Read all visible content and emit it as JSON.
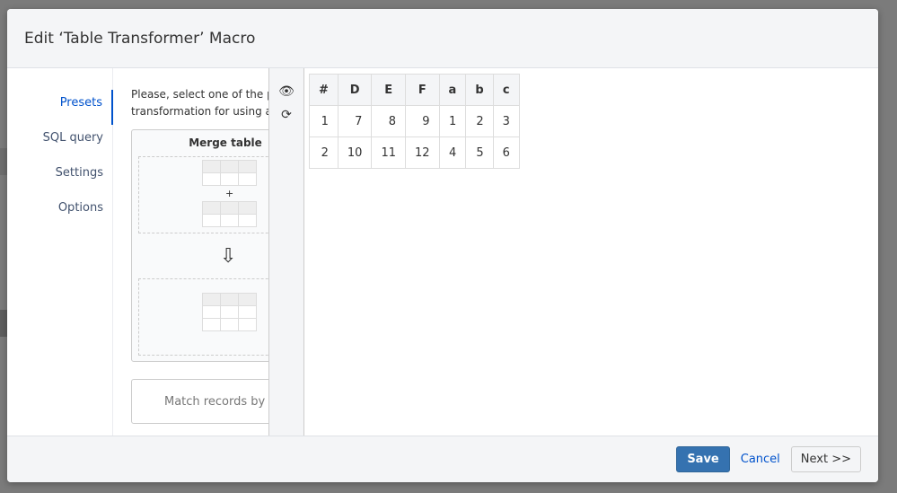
{
  "dialog": {
    "title": "Edit ‘Table Transformer’ Macro"
  },
  "nav": {
    "items": [
      {
        "label": "Presets",
        "active": true
      },
      {
        "label": "SQL query"
      },
      {
        "label": "Settings"
      },
      {
        "label": "Options"
      }
    ]
  },
  "presets": {
    "intro_line1": "Please, select one of the p",
    "intro_line2": "transformation for using a",
    "card_title": "Merge table",
    "plus": "+",
    "arrow": "⇩",
    "match_label": "Match records by"
  },
  "tools": {
    "preview_icon": "eye-icon",
    "refresh_icon": "refresh-icon"
  },
  "result": {
    "headers": [
      "#",
      "D",
      "E",
      "F",
      "a",
      "b",
      "c"
    ],
    "rows": [
      [
        "1",
        "7",
        "8",
        "9",
        "1",
        "2",
        "3"
      ],
      [
        "2",
        "10",
        "11",
        "12",
        "4",
        "5",
        "6"
      ]
    ]
  },
  "footer": {
    "save": "Save",
    "cancel": "Cancel",
    "next": "Next >>"
  }
}
